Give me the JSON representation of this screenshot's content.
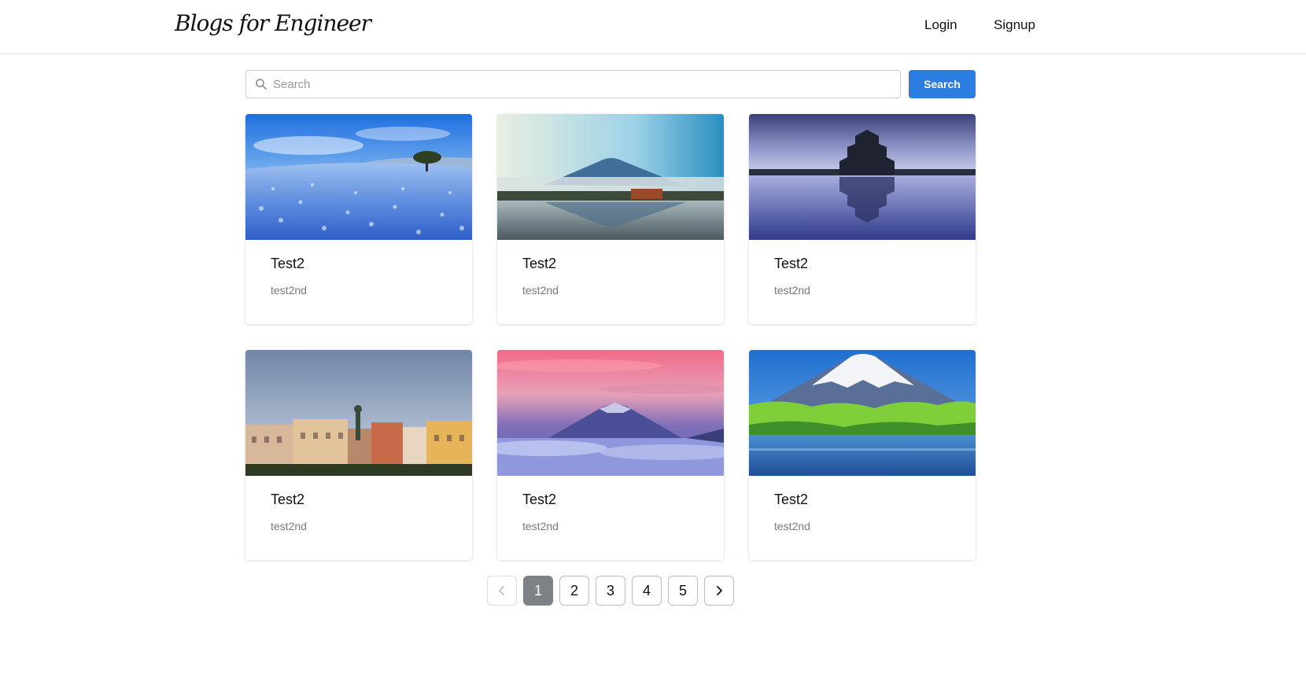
{
  "header": {
    "logo": "Blogs for Engineer",
    "login_label": "Login",
    "signup_label": "Signup"
  },
  "search": {
    "placeholder": "Search",
    "value": "",
    "button_label": "Search"
  },
  "cards": [
    {
      "title": "Test2",
      "subtitle": "test2nd",
      "image": "blue-flower-field-landscape"
    },
    {
      "title": "Test2",
      "subtitle": "test2nd",
      "image": "mount-fuji-lake-reflection"
    },
    {
      "title": "Test2",
      "subtitle": "test2nd",
      "image": "japanese-castle-reflection"
    },
    {
      "title": "Test2",
      "subtitle": "test2nd",
      "image": "european-city-buildings"
    },
    {
      "title": "Test2",
      "subtitle": "test2nd",
      "image": "mount-fuji-sunset-clouds"
    },
    {
      "title": "Test2",
      "subtitle": "test2nd",
      "image": "mount-fuji-green-trees-lake"
    }
  ],
  "pagination": {
    "prev_icon": "chevron-left-icon",
    "next_icon": "chevron-right-icon",
    "pages": [
      "1",
      "2",
      "3",
      "4",
      "5"
    ],
    "current": "1"
  },
  "colors": {
    "accent": "#2b7de1",
    "active_page": "#7d8287"
  }
}
